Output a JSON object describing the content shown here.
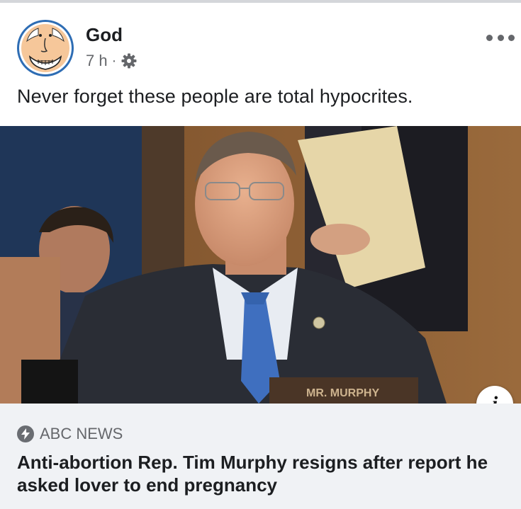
{
  "post": {
    "author": "God",
    "timestamp": "7 h",
    "separator": "·",
    "privacy_icon": "gear-icon",
    "menu_icon": "more-icon",
    "text": "Never forget these people are total hypocrites."
  },
  "photo": {
    "nameplate_text": "MR. MURPHY"
  },
  "link": {
    "info_label": "i",
    "source_icon": "bolt-icon",
    "source": "ABC NEWS",
    "headline": "Anti-abortion Rep. Tim Murphy resigns after report he asked lover to end pregnancy"
  },
  "colors": {
    "avatar_ring": "#2e6db4",
    "secondary_text": "#65676b",
    "link_background": "#f0f2f5"
  }
}
